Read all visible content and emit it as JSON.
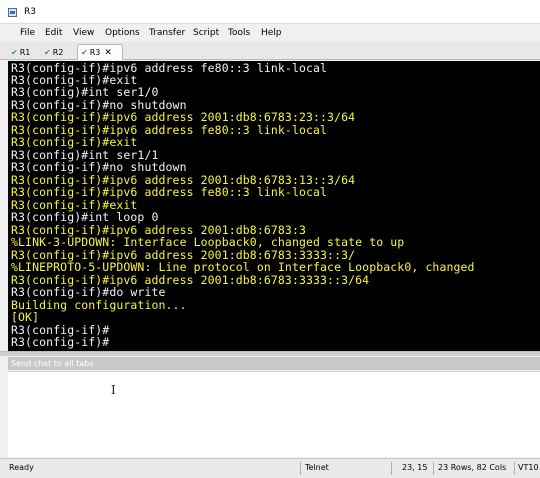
{
  "window": {
    "title": "R3"
  },
  "menu": [
    "File",
    "Edit",
    "View",
    "Options",
    "Transfer",
    "Script",
    "Tools",
    "Help"
  ],
  "tabs": [
    {
      "label": "R1",
      "active": false
    },
    {
      "label": "R2",
      "active": false
    },
    {
      "label": "R3",
      "active": true
    }
  ],
  "terminal": {
    "lines": [
      {
        "text": "R3(config-if)#ipv6 address fe80::3 link-local",
        "color": "white"
      },
      {
        "text": "R3(config-if)#exit",
        "color": "white"
      },
      {
        "text": "R3(config)#int ser1/0",
        "color": "white"
      },
      {
        "text": "R3(config-if)#no shutdown",
        "color": "white"
      },
      {
        "text": "R3(config-if)#ipv6 address 2001:db8:6783:23::3/64",
        "color": "yellow"
      },
      {
        "text": "R3(config-if)#ipv6 address fe80::3 link-local",
        "color": "yellow"
      },
      {
        "text": "R3(config-if)#exit",
        "color": "yellow"
      },
      {
        "text": "R3(config)#int ser1/1",
        "color": "white"
      },
      {
        "text": "R3(config-if)#no shutdown",
        "color": "white"
      },
      {
        "text": "R3(config-if)#ipv6 address 2001:db8:6783:13::3/64",
        "color": "yellow"
      },
      {
        "text": "R3(config-if)#ipv6 address fe80::3 link-local",
        "color": "yellow"
      },
      {
        "text": "R3(config-if)#exit",
        "color": "yellow"
      },
      {
        "text": "R3(config)#int loop 0",
        "color": "white"
      },
      {
        "text": "R3(config-if)#ipv6 address 2001:db8:6783:3",
        "color": "yellow"
      },
      {
        "text": "%LINK-3-UPDOWN: Interface Loopback0, changed state to up",
        "color": "yellow"
      },
      {
        "text": "R3(config-if)#ipv6 address 2001:db8:6783:3333::3/",
        "color": "yellow"
      },
      {
        "text": "%LINEPROTO-5-UPDOWN: Line protocol on Interface Loopback0, changed",
        "color": "yellow"
      },
      {
        "text": "R3(config-if)#ipv6 address 2001:db8:6783:3333::3/64",
        "color": "yellow"
      },
      {
        "text": "R3(config-if)#do write",
        "color": "white"
      },
      {
        "text": "Building configuration...",
        "color": "yellow"
      },
      {
        "text": "[OK]",
        "color": "yellow"
      },
      {
        "text": "R3(config-if)#",
        "color": "white"
      },
      {
        "text": "R3(config-if)#",
        "color": "white"
      }
    ]
  },
  "chat": {
    "placeholder": "Send chat to all tabs"
  },
  "status": {
    "state": "Ready",
    "protocol": "Telnet",
    "cursor_pos": "23, 15",
    "dimensions": "23 Rows, 82 Cols",
    "emulation": "VT10"
  }
}
